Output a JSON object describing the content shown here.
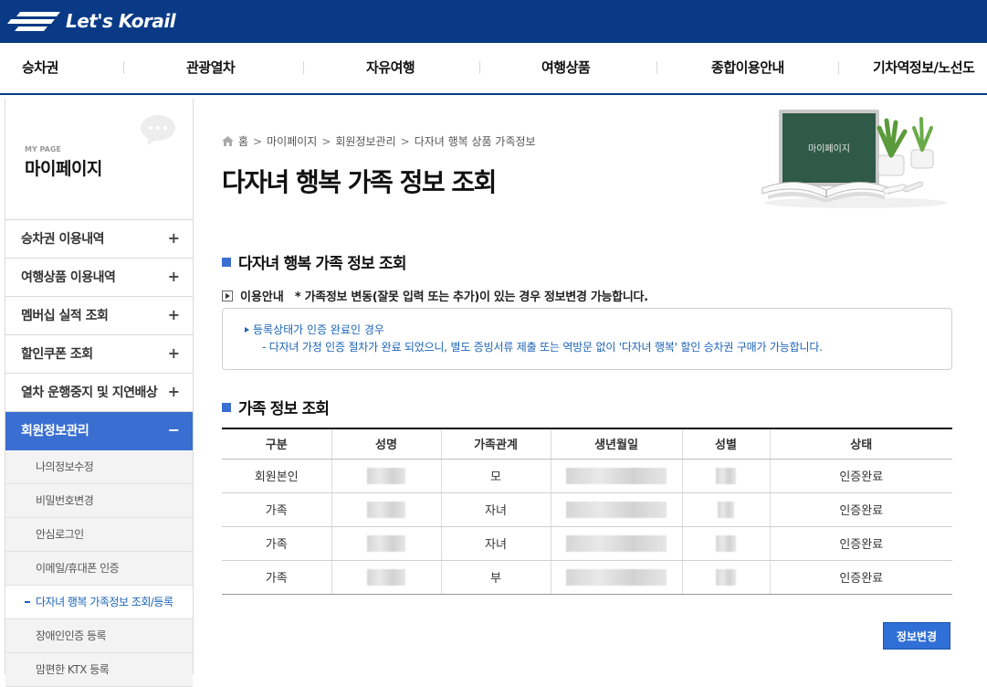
{
  "brand": {
    "name": "Let's Korail"
  },
  "gnb": [
    "승차권",
    "관광열차",
    "자유여행",
    "여행상품",
    "종합이용안내",
    "기차역정보/노선도"
  ],
  "sidebar": {
    "eng_label": "MY PAGE",
    "title": "마이페이지",
    "menu": [
      {
        "label": "승차권 이용내역",
        "toggle": "+"
      },
      {
        "label": "여행상품 이용내역",
        "toggle": "+"
      },
      {
        "label": "멤버십 실적 조회",
        "toggle": "+"
      },
      {
        "label": "할인쿠폰 조회",
        "toggle": "+"
      },
      {
        "label": "열차 운행중지 및 지연배상",
        "toggle": "+"
      },
      {
        "label": "회원정보관리",
        "toggle": "−"
      }
    ],
    "submenu": [
      {
        "label": "나의정보수정"
      },
      {
        "label": "비밀번호변경"
      },
      {
        "label": "안심로그인"
      },
      {
        "label": "이메일/휴대폰 인증"
      },
      {
        "label": "다자녀 행복 가족정보 조회/등록"
      },
      {
        "label": "장애인인증 등록"
      },
      {
        "label": "맘편한 KTX 등록"
      }
    ]
  },
  "breadcrumb": [
    "홈",
    "마이페이지",
    "회원정보관리",
    "다자녀 행복 상품 가족정보"
  ],
  "page_title": "다자녀 행복 가족 정보 조회",
  "illust_board_text": "마이페이지",
  "section1": {
    "title": "다자녀 행복 가족 정보 조회",
    "notice_lead": "이용안내",
    "notice_msg": "* 가족정보 변동(잘못 입력 또는 추가)이 있는 경우 정보변경 가능합니다.",
    "info_line1": "등록상태가 인증 완료인 경우",
    "info_line2": "- 다자녀 가정 인증 절차가 완료 되었으니, 별도 증빙서류 제출 또는 역방문 없이 '다자녀 행복' 할인 승차권 구매가 가능합니다."
  },
  "section2": {
    "title": "가족 정보 조회",
    "columns": [
      "구분",
      "성명",
      "가족관계",
      "생년월일",
      "성별",
      "상태"
    ],
    "rows": [
      {
        "type": "회원본인",
        "relation": "모",
        "status": "인증완료"
      },
      {
        "type": "가족",
        "relation": "자녀",
        "status": "인증완료"
      },
      {
        "type": "가족",
        "relation": "자녀",
        "status": "인증완료"
      },
      {
        "type": "가족",
        "relation": "부",
        "status": "인증완료"
      }
    ]
  },
  "buttons": {
    "change": "정보변경"
  },
  "colors": {
    "brand_navy": "#0a3a86",
    "accent_blue": "#3a6ed1",
    "info_blue": "#1c63b7"
  }
}
